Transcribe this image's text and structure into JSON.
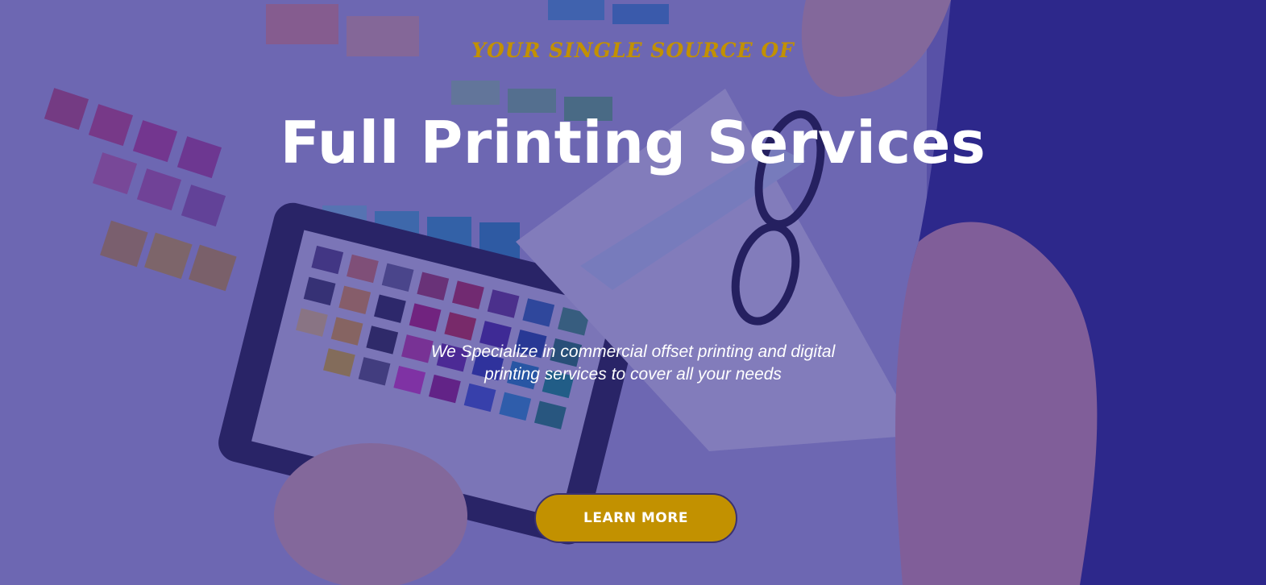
{
  "hero": {
    "eyebrow": "YOUR SINGLE SOURCE OF",
    "headline": "Full Printing Services",
    "subtext": "We Specialize in commercial offset printing and digital printing services to cover all your needs",
    "cta_label": "LEARN MORE"
  },
  "colors": {
    "accent": "#c29100",
    "overlay": "#30268c",
    "text": "#ffffff"
  }
}
